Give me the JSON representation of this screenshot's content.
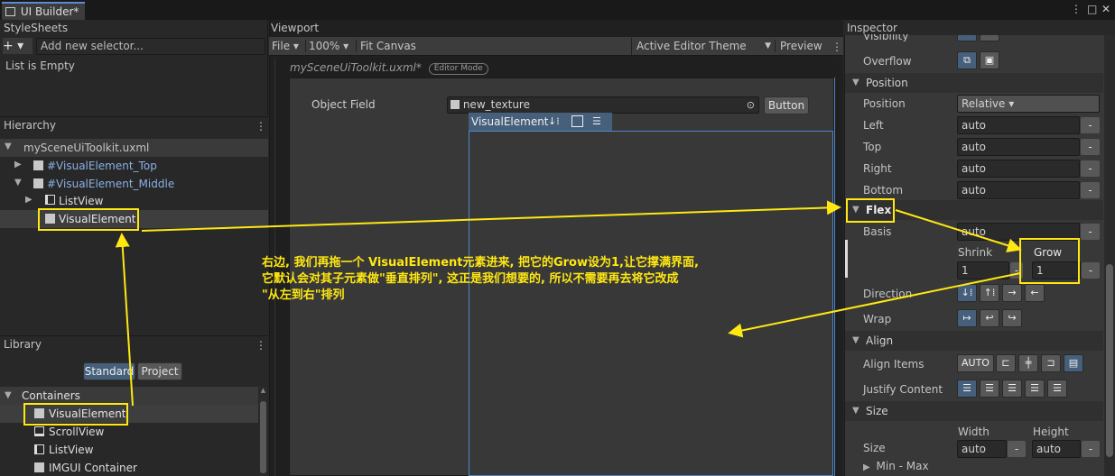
{
  "window": {
    "tab_title": "UI Builder*",
    "tab_icon": "window-icon",
    "controls": [
      "⋮",
      "□",
      "✕"
    ]
  },
  "stylesheets": {
    "title": "StyleSheets",
    "add_symbol": "+ ▾",
    "selector_placeholder": "Add new selector...",
    "empty_text": "List is Empty"
  },
  "hierarchy": {
    "title": "Hierarchy",
    "menu": "⋮",
    "root": "mySceneUiToolkit.uxml",
    "items": [
      {
        "label": "#VisualElement_Top",
        "arrow": "▶"
      },
      {
        "label": "#VisualElement_Middle",
        "arrow": "▼"
      },
      {
        "label": "ListView",
        "arrow": "▶"
      },
      {
        "label": "VisualElement",
        "arrow": ""
      }
    ]
  },
  "library": {
    "title": "Library",
    "menu": "⋮",
    "tab_standard": "Standard",
    "tab_project": "Project",
    "group": "Containers",
    "items": [
      "VisualElement",
      "ScrollView",
      "ListView",
      "IMGUI Container"
    ]
  },
  "viewport": {
    "title": "Viewport",
    "file_menu": "File ▾",
    "zoom": "100% ▾",
    "fit_canvas": "Fit Canvas",
    "theme": "Active Editor Theme",
    "preview": "Preview",
    "document_title": "mySceneUiToolkit.uxml*",
    "mode_badge": "Editor Mode",
    "object_field_label": "Object Field",
    "object_field_value": "new_texture",
    "object_field_button": "Button",
    "visual_element_tag": "VisualElement"
  },
  "inspector": {
    "title": "Inspector",
    "visibility_label": "Visibility",
    "overflow_label": "Overflow",
    "position_section": "Position",
    "position_rows": [
      {
        "label": "Position",
        "value": "Relative ▾"
      },
      {
        "label": "Left",
        "value": "auto"
      },
      {
        "label": "Top",
        "value": "auto"
      },
      {
        "label": "Right",
        "value": "auto"
      },
      {
        "label": "Bottom",
        "value": "auto"
      }
    ],
    "flex_section": "Flex",
    "basis_label": "Basis",
    "basis_value": "auto",
    "shrink_label": "Shrink",
    "shrink_value": "1",
    "grow_label": "Grow",
    "grow_value": "1",
    "direction_label": "Direction",
    "wrap_label": "Wrap",
    "align_section": "Align",
    "align_items_label": "Align Items",
    "align_items_auto": "AUTO",
    "justify_label": "Justify Content",
    "size_section": "Size",
    "size_label": "Size",
    "width_label": "Width",
    "height_label": "Height",
    "width_value": "auto",
    "height_value": "auto",
    "minmax_label": "Min - Max",
    "dash": "-"
  },
  "annotation": {
    "line1": "右边, 我们再拖一个 VisualElement元素进来, 把它的Grow设为1,让它撑满界面,",
    "line2": "它默认会对其子元素做\"垂直排列\", 这正是我们想要的, 所以不需要再去将它改成",
    "line3": "\"从左到右\"排列",
    "color": "#ffe812"
  }
}
